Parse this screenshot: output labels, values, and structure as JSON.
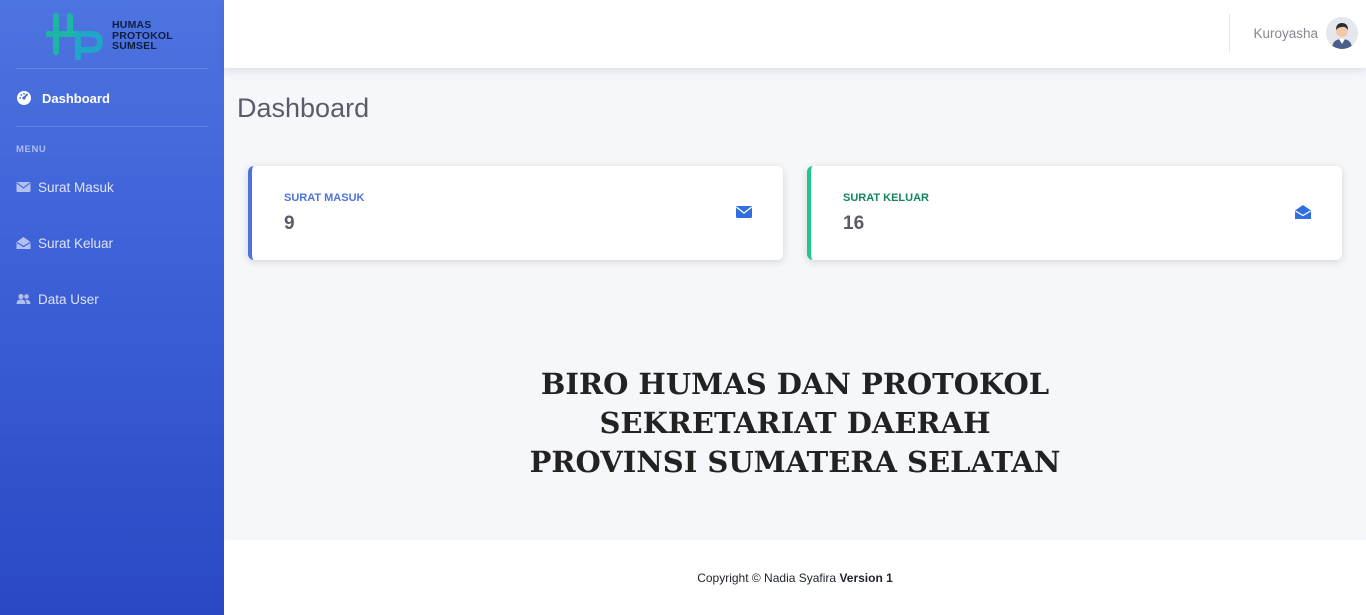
{
  "brand": {
    "line1": "HUMAS",
    "line2": "PROTOKOL",
    "line3": "SUMSEL",
    "icon": "hp-logo"
  },
  "sidebar": {
    "dashboard": {
      "label": "Dashboard",
      "icon": "tachometer-icon"
    },
    "heading": "MENU",
    "items": [
      {
        "label": "Surat Masuk",
        "icon": "envelope-icon"
      },
      {
        "label": "Surat Keluar",
        "icon": "envelope-open-icon"
      },
      {
        "label": "Data User",
        "icon": "users-icon"
      }
    ]
  },
  "topbar": {
    "user_name": "Kuroyasha",
    "avatar_icon": "user-avatar"
  },
  "main": {
    "title": "Dashboard",
    "cards": [
      {
        "label": "SURAT MASUK",
        "value": "9",
        "icon": "envelope-icon",
        "accent": "#4e73df"
      },
      {
        "label": "SURAT KELUAR",
        "value": "16",
        "icon": "envelope-open-icon",
        "accent": "#1cc88a"
      }
    ],
    "org": {
      "line1": "BIRO HUMAS DAN PROTOKOL",
      "line2": "SEKRETARIAT DAERAH",
      "line3": "PROVINSI SUMATERA SELATAN"
    }
  },
  "footer": {
    "prefix": "Copyright © Nadia Syafira",
    "version": "Version 1"
  },
  "colors": {
    "sidebar_top": "#4d74e0",
    "sidebar_bottom": "#2a48c4",
    "primary": "#4e73df",
    "success": "#1cc88a"
  }
}
